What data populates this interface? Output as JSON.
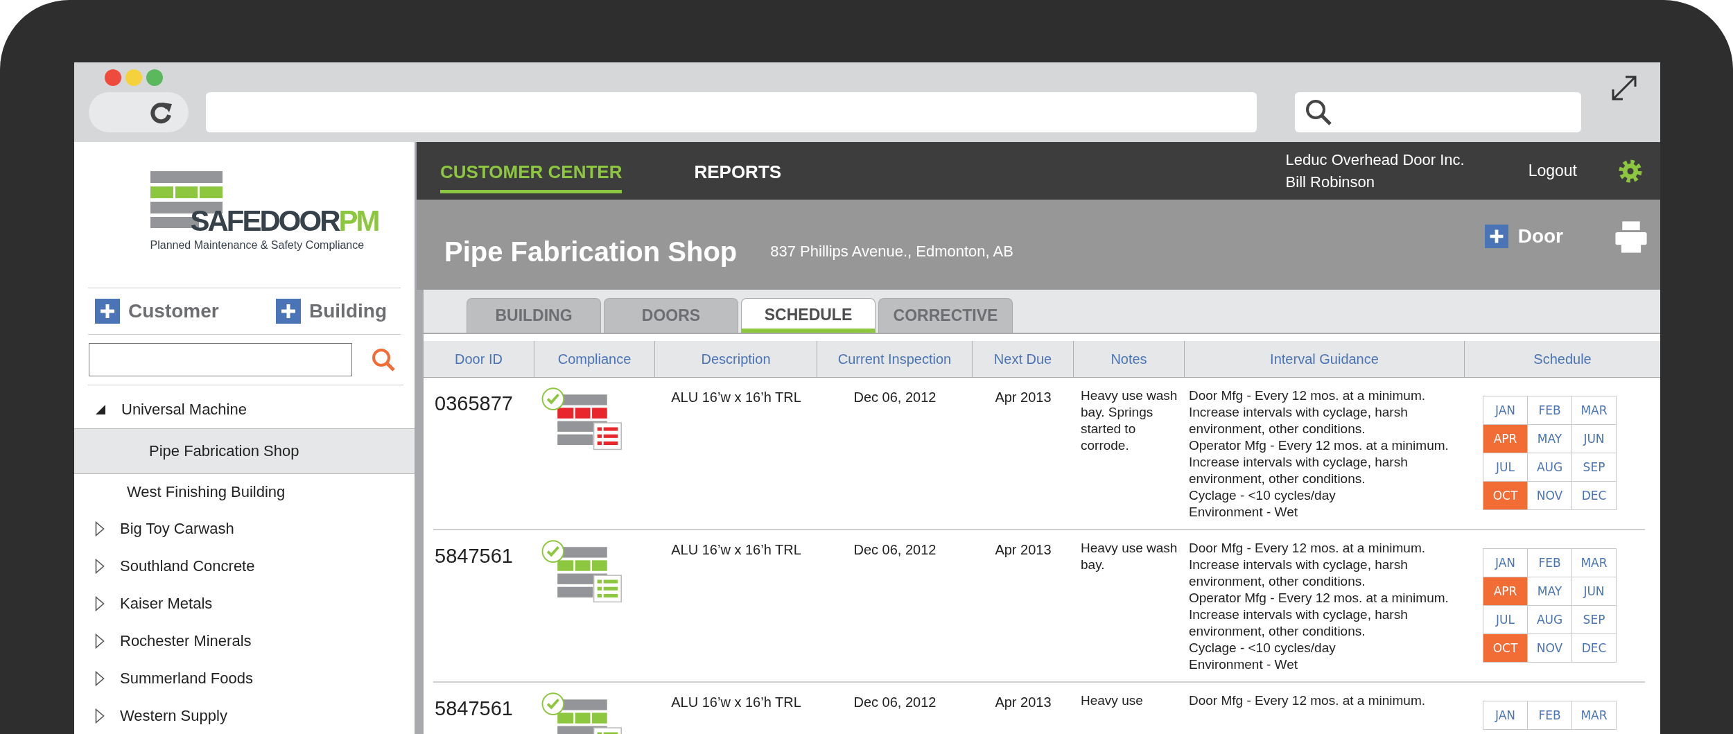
{
  "sidebar": {
    "logo": {
      "name_dark": "SAFEDOOR",
      "name_accent": "PM",
      "tagline": "Planned Maintenance & Safety Compliance"
    },
    "add_buttons": [
      {
        "label": "Customer"
      },
      {
        "label": "Building"
      }
    ],
    "tree": [
      {
        "label": "Universal Machine",
        "expanded": true,
        "selected": false,
        "children": [
          {
            "label": "Pipe Fabrication Shop",
            "selected": true
          },
          {
            "label": "West Finishing Building",
            "selected": false
          }
        ]
      },
      {
        "label": "Big Toy Carwash",
        "expanded": false,
        "selected": false
      },
      {
        "label": "Southland Concrete",
        "expanded": false,
        "selected": false
      },
      {
        "label": "Kaiser Metals",
        "expanded": false,
        "selected": false
      },
      {
        "label": "Rochester Minerals",
        "expanded": false,
        "selected": false
      },
      {
        "label": "Summerland Foods",
        "expanded": false,
        "selected": false
      },
      {
        "label": "Western Supply",
        "expanded": false,
        "selected": false
      }
    ]
  },
  "nav": {
    "tabs": [
      {
        "label": "CUSTOMER CENTER",
        "selected": true
      },
      {
        "label": "REPORTS",
        "selected": false
      }
    ],
    "account": {
      "company": "Leduc Overhead Door Inc.",
      "user": "Bill Robinson"
    },
    "logout": "Logout"
  },
  "header": {
    "title": "Pipe Fabrication Shop",
    "address": "837 Phillips Avenue., Edmonton, AB",
    "add_button": "Door"
  },
  "tabs": [
    {
      "label": "BUILDING",
      "selected": false
    },
    {
      "label": "DOORS",
      "selected": false
    },
    {
      "label": "SCHEDULE",
      "selected": true
    },
    {
      "label": "CORRECTIVE",
      "selected": false
    }
  ],
  "table": {
    "columns": [
      "Door ID",
      "Compliance",
      "Description",
      "Current Inspection",
      "Next Due",
      "Notes",
      "Interval Guidance",
      "Schedule"
    ],
    "rows": [
      {
        "door_id": "0365877",
        "compliant": false,
        "description": "ALU 16’w x 16’h TRL",
        "current_inspection": "Dec 06, 2012",
        "next_due": "Apr 2013",
        "notes": "Heavy use wash bay. Springs started to corrode.",
        "interval_guidance": [
          "Door Mfg - Every 12 mos. at a minimum. Increase intervals with cyclage, harsh environment, other conditions.",
          "Operator Mfg - Every 12 mos. at a minimum.  Increase intervals with cyclage, harsh environment, other conditions.",
          "Cyclage - <10 cycles/day",
          "Environment - Wet"
        ],
        "months": [
          {
            "label": "JAN",
            "selected": false
          },
          {
            "label": "FEB",
            "selected": false
          },
          {
            "label": "MAR",
            "selected": false
          },
          {
            "label": "APR",
            "selected": true
          },
          {
            "label": "MAY",
            "selected": false
          },
          {
            "label": "JUN",
            "selected": false
          },
          {
            "label": "JUL",
            "selected": false
          },
          {
            "label": "AUG",
            "selected": false
          },
          {
            "label": "SEP",
            "selected": false
          },
          {
            "label": "OCT",
            "selected": true
          },
          {
            "label": "NOV",
            "selected": false
          },
          {
            "label": "DEC",
            "selected": false
          }
        ]
      },
      {
        "door_id": "5847561",
        "compliant": true,
        "description": "ALU 16’w x 16’h TRL",
        "current_inspection": "Dec 06, 2012",
        "next_due": "Apr 2013",
        "notes": "Heavy use wash bay.",
        "interval_guidance": [
          "Door Mfg - Every 12 mos. at a minimum. Increase intervals with cyclage, harsh environment, other conditions.",
          "Operator Mfg - Every 12 mos. at a minimum.  Increase intervals with cyclage, harsh environment, other conditions.",
          "Cyclage - <10 cycles/day",
          "Environment - Wet"
        ],
        "months": [
          {
            "label": "JAN",
            "selected": false
          },
          {
            "label": "FEB",
            "selected": false
          },
          {
            "label": "MAR",
            "selected": false
          },
          {
            "label": "APR",
            "selected": true
          },
          {
            "label": "MAY",
            "selected": false
          },
          {
            "label": "JUN",
            "selected": false
          },
          {
            "label": "JUL",
            "selected": false
          },
          {
            "label": "AUG",
            "selected": false
          },
          {
            "label": "SEP",
            "selected": false
          },
          {
            "label": "OCT",
            "selected": true
          },
          {
            "label": "NOV",
            "selected": false
          },
          {
            "label": "DEC",
            "selected": false
          }
        ]
      },
      {
        "door_id": "5847561",
        "compliant": true,
        "description": "ALU 16’w x 16’h TRL",
        "current_inspection": "Dec 06, 2012",
        "next_due": "Apr 2013",
        "notes": "Heavy use",
        "interval_guidance": [
          "Door Mfg - Every 12 mos. at a minimum."
        ],
        "months": [
          {
            "label": "JAN",
            "selected": false
          },
          {
            "label": "FEB",
            "selected": false
          },
          {
            "label": "MAR",
            "selected": false
          }
        ]
      }
    ]
  }
}
